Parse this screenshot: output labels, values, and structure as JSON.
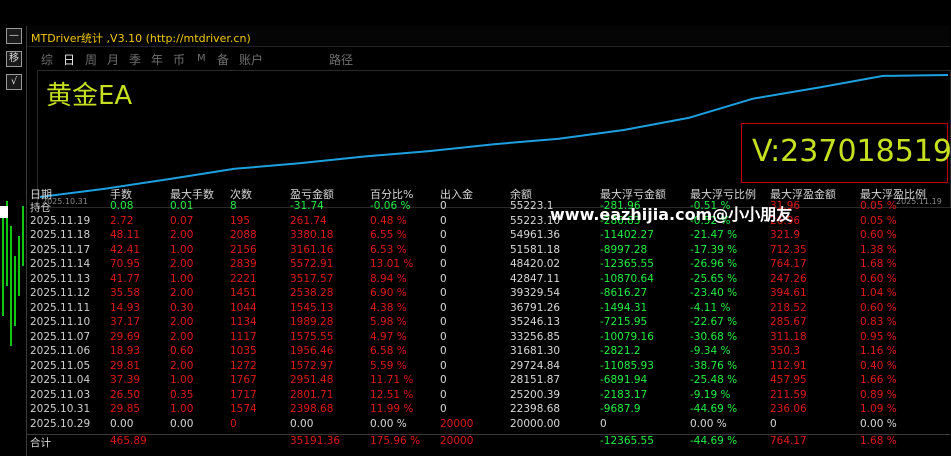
{
  "window": {
    "title": "MTDriver统计 ,V3.10 (http://mtdriver.cn)"
  },
  "left_buttons": [
    "—",
    "移",
    "√"
  ],
  "tabs": [
    {
      "label": "综",
      "active": false
    },
    {
      "label": "日",
      "active": true
    },
    {
      "label": "周",
      "active": false
    },
    {
      "label": "月",
      "active": false
    },
    {
      "label": "季",
      "active": false
    },
    {
      "label": "年",
      "active": false
    },
    {
      "label": "币",
      "active": false
    },
    {
      "label": "M",
      "active": false
    },
    {
      "label": "备",
      "active": false
    },
    {
      "label": "账户",
      "active": false
    },
    {
      "label": "路径",
      "active": false
    }
  ],
  "chart": {
    "title": "黄金EA",
    "x_start": "2025.10.31",
    "x_end": "2025.11.19",
    "account": "V:237018519",
    "line_color": "#1ea0e0"
  },
  "chart_data": {
    "type": "line",
    "title": "黄金EA",
    "x": [
      "2025.10.29",
      "2025.10.31",
      "2025.11.03",
      "2025.11.04",
      "2025.11.05",
      "2025.11.06",
      "2025.11.07",
      "2025.11.10",
      "2025.11.11",
      "2025.11.12",
      "2025.11.13",
      "2025.11.14",
      "2025.11.17",
      "2025.11.18",
      "2025.11.19"
    ],
    "series": [
      {
        "values": [
          20000.0,
          22398.68,
          25200.39,
          28151.87,
          29724.84,
          31681.3,
          33256.85,
          35246.13,
          36791.26,
          39329.54,
          42847.11,
          48420.02,
          51581.18,
          54961.36,
          55223.1
        ]
      }
    ]
  },
  "watermark": "www.eazhijia.com@小小朋友",
  "table": {
    "headers": [
      "日期",
      "手数",
      "最大手数",
      "次数",
      "盈亏金额",
      "百分比%",
      "出入金",
      "余额",
      "最大浮亏金额",
      "最大浮亏比例",
      "最大浮盈金额",
      "最大浮盈比例"
    ],
    "rows": [
      [
        "持仓",
        "0.08",
        "0.01",
        "8",
        "-31.74",
        "-0.06 %",
        "0",
        "55223.1",
        "-281.96",
        "-0.51 %",
        "31.96",
        "0.05 %"
      ],
      [
        "2025.11.19",
        "2.72",
        "0.07",
        "195",
        "261.74",
        "0.48 %",
        "0",
        "55223.10",
        "-286.83",
        "-0.52 %",
        "26.96",
        "0.05 %"
      ],
      [
        "2025.11.18",
        "48.11",
        "2.00",
        "2088",
        "3380.18",
        "6.55 %",
        "0",
        "54961.36",
        "-11402.27",
        "-21.47 %",
        "321.9",
        "0.60 %"
      ],
      [
        "2025.11.17",
        "42.41",
        "1.00",
        "2156",
        "3161.16",
        "6.53 %",
        "0",
        "51581.18",
        "-8997.28",
        "-17.39 %",
        "712.35",
        "1.38 %"
      ],
      [
        "2025.11.14",
        "70.95",
        "2.00",
        "2839",
        "5572.91",
        "13.01 %",
        "0",
        "48420.02",
        "-12365.55",
        "-26.96 %",
        "764.17",
        "1.68 %"
      ],
      [
        "2025.11.13",
        "41.77",
        "1.00",
        "2221",
        "3517.57",
        "8.94 %",
        "0",
        "42847.11",
        "-10870.64",
        "-25.65 %",
        "247.26",
        "0.60 %"
      ],
      [
        "2025.11.12",
        "35.58",
        "2.00",
        "1451",
        "2538.28",
        "6.90 %",
        "0",
        "39329.54",
        "-8616.27",
        "-23.40 %",
        "394.61",
        "1.04 %"
      ],
      [
        "2025.11.11",
        "14.93",
        "0.30",
        "1044",
        "1545.13",
        "4.38 %",
        "0",
        "36791.26",
        "-1494.31",
        "-4.11 %",
        "218.52",
        "0.60 %"
      ],
      [
        "2025.11.10",
        "37.17",
        "2.00",
        "1134",
        "1989.28",
        "5.98 %",
        "0",
        "35246.13",
        "-7215.95",
        "-22.67 %",
        "285.67",
        "0.83 %"
      ],
      [
        "2025.11.07",
        "29.69",
        "2.00",
        "1117",
        "1575.55",
        "4.97 %",
        "0",
        "33256.85",
        "-10079.16",
        "-30.68 %",
        "311.18",
        "0.95 %"
      ],
      [
        "2025.11.06",
        "18.93",
        "0.60",
        "1035",
        "1956.46",
        "6.58 %",
        "0",
        "31681.30",
        "-2821.2",
        "-9.34 %",
        "350.3",
        "1.16 %"
      ],
      [
        "2025.11.05",
        "29.81",
        "2.00",
        "1272",
        "1572.97",
        "5.59 %",
        "0",
        "29724.84",
        "-11085.93",
        "-38.76 %",
        "112.91",
        "0.40 %"
      ],
      [
        "2025.11.04",
        "37.39",
        "1.00",
        "1767",
        "2951.48",
        "11.71 %",
        "0",
        "28151.87",
        "-6891.94",
        "-25.48 %",
        "457.95",
        "1.66 %"
      ],
      [
        "2025.11.03",
        "26.50",
        "0.35",
        "1717",
        "2801.71",
        "12.51 %",
        "0",
        "25200.39",
        "-2183.17",
        "-9.19 %",
        "211.59",
        "0.89 %"
      ],
      [
        "2025.10.31",
        "29.85",
        "1.00",
        "1574",
        "2398.68",
        "11.99 %",
        "0",
        "22398.68",
        "-9687.9",
        "-44.69 %",
        "236.06",
        "1.09 %"
      ],
      [
        "2025.10.29",
        "0.00",
        "0.00",
        "0",
        "0.00",
        "0.00 %",
        "20000",
        "20000.00",
        "0",
        "0.00 %",
        "0",
        "0.00 %"
      ]
    ],
    "total": [
      "合计",
      "465.89",
      "",
      "",
      "35191.36",
      "175.96 %",
      "20000",
      "",
      "-12365.55",
      "-44.69 %",
      "764.17",
      "1.68 %"
    ]
  },
  "colors": {
    "positive": "#e01818",
    "negative": "#22ee44",
    "accent": "#c6e020",
    "title": "#f0c800",
    "box": "#c00000"
  }
}
